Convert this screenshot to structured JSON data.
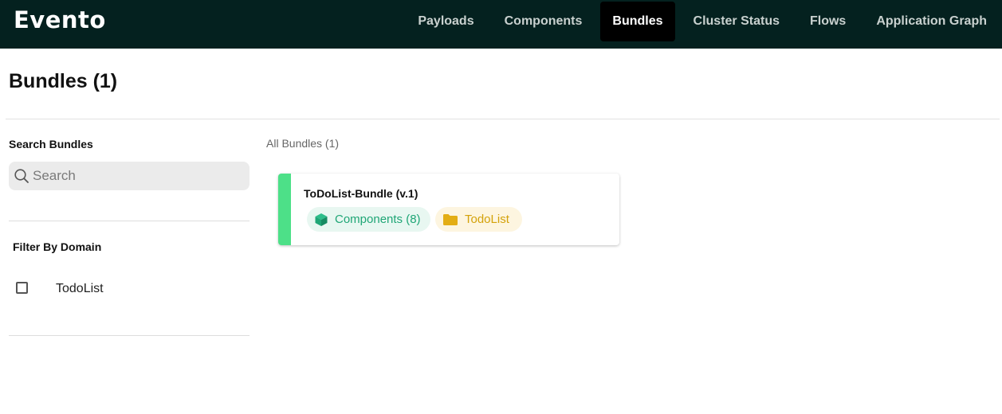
{
  "app": {
    "logo": "Evento"
  },
  "nav": {
    "items": [
      {
        "label": "Payloads"
      },
      {
        "label": "Components"
      },
      {
        "label": "Bundles"
      },
      {
        "label": "Cluster Status"
      },
      {
        "label": "Flows"
      },
      {
        "label": "Application Graph"
      }
    ],
    "active": "Bundles"
  },
  "page": {
    "title": "Bundles (1)"
  },
  "sidebar": {
    "search_label": "Search Bundles",
    "search_placeholder": "Search",
    "filter_label": "Filter By Domain",
    "domains": [
      {
        "label": "TodoList",
        "checked": false
      }
    ]
  },
  "main": {
    "all_label": "All Bundles (1)",
    "bundles": [
      {
        "title": "ToDoList-Bundle (v.1)",
        "components_chip": "Components (8)",
        "domain_chip": "TodoList"
      }
    ]
  },
  "colors": {
    "topbar": "#04211f",
    "card_accent": "#4de088",
    "components_chip": "#1fa676",
    "domain_chip": "#d4a20a"
  }
}
